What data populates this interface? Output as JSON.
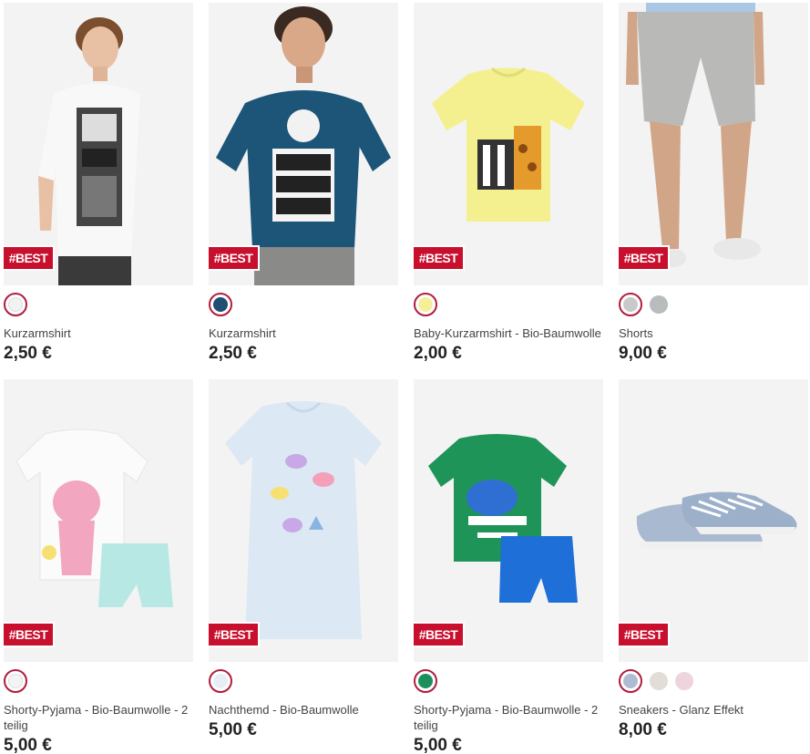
{
  "badge_text": "#BEST",
  "colors": {
    "badge": "#c8102e",
    "selected_ring": "#b01e3c"
  },
  "products": [
    {
      "name": "Kurzarmshirt",
      "price": "2,50 €",
      "image": "boy-white-tshirt",
      "swatches": [
        "#f2f2f2"
      ]
    },
    {
      "name": "Kurzarmshirt",
      "price": "2,50 €",
      "image": "boy-navy-tshirt",
      "swatches": [
        "#1f4e73"
      ]
    },
    {
      "name": "Baby-Kurzarmshirt - Bio-Baumwolle",
      "price": "2,00 €",
      "image": "yellow-baby-tshirt",
      "swatches": [
        "#f5ef9a"
      ]
    },
    {
      "name": "Shorts",
      "price": "9,00 €",
      "image": "grey-shorts",
      "swatches": [
        "#c9c9c9",
        "#b8bcbc"
      ]
    },
    {
      "name": "Shorty-Pyjama - Bio-Baumwolle - 2 teilig",
      "price": "5,00 €",
      "image": "white-pyjama-set",
      "swatches": [
        "#f4f4f4"
      ]
    },
    {
      "name": "Nachthemd - Bio-Baumwolle",
      "price": "5,00 €",
      "image": "lightblue-nightdress",
      "swatches": [
        "#e8eef5"
      ]
    },
    {
      "name": "Shorty-Pyjama - Bio-Baumwolle - 2 teilig",
      "price": "5,00 €",
      "image": "green-pyjama-set",
      "swatches": [
        "#1e8f5c"
      ]
    },
    {
      "name": "Sneakers - Glanz Effekt",
      "price": "8,00 €",
      "image": "blue-sneakers",
      "swatches": [
        "#aebbd0",
        "#e3ddd8",
        "#eed4dd"
      ]
    }
  ]
}
